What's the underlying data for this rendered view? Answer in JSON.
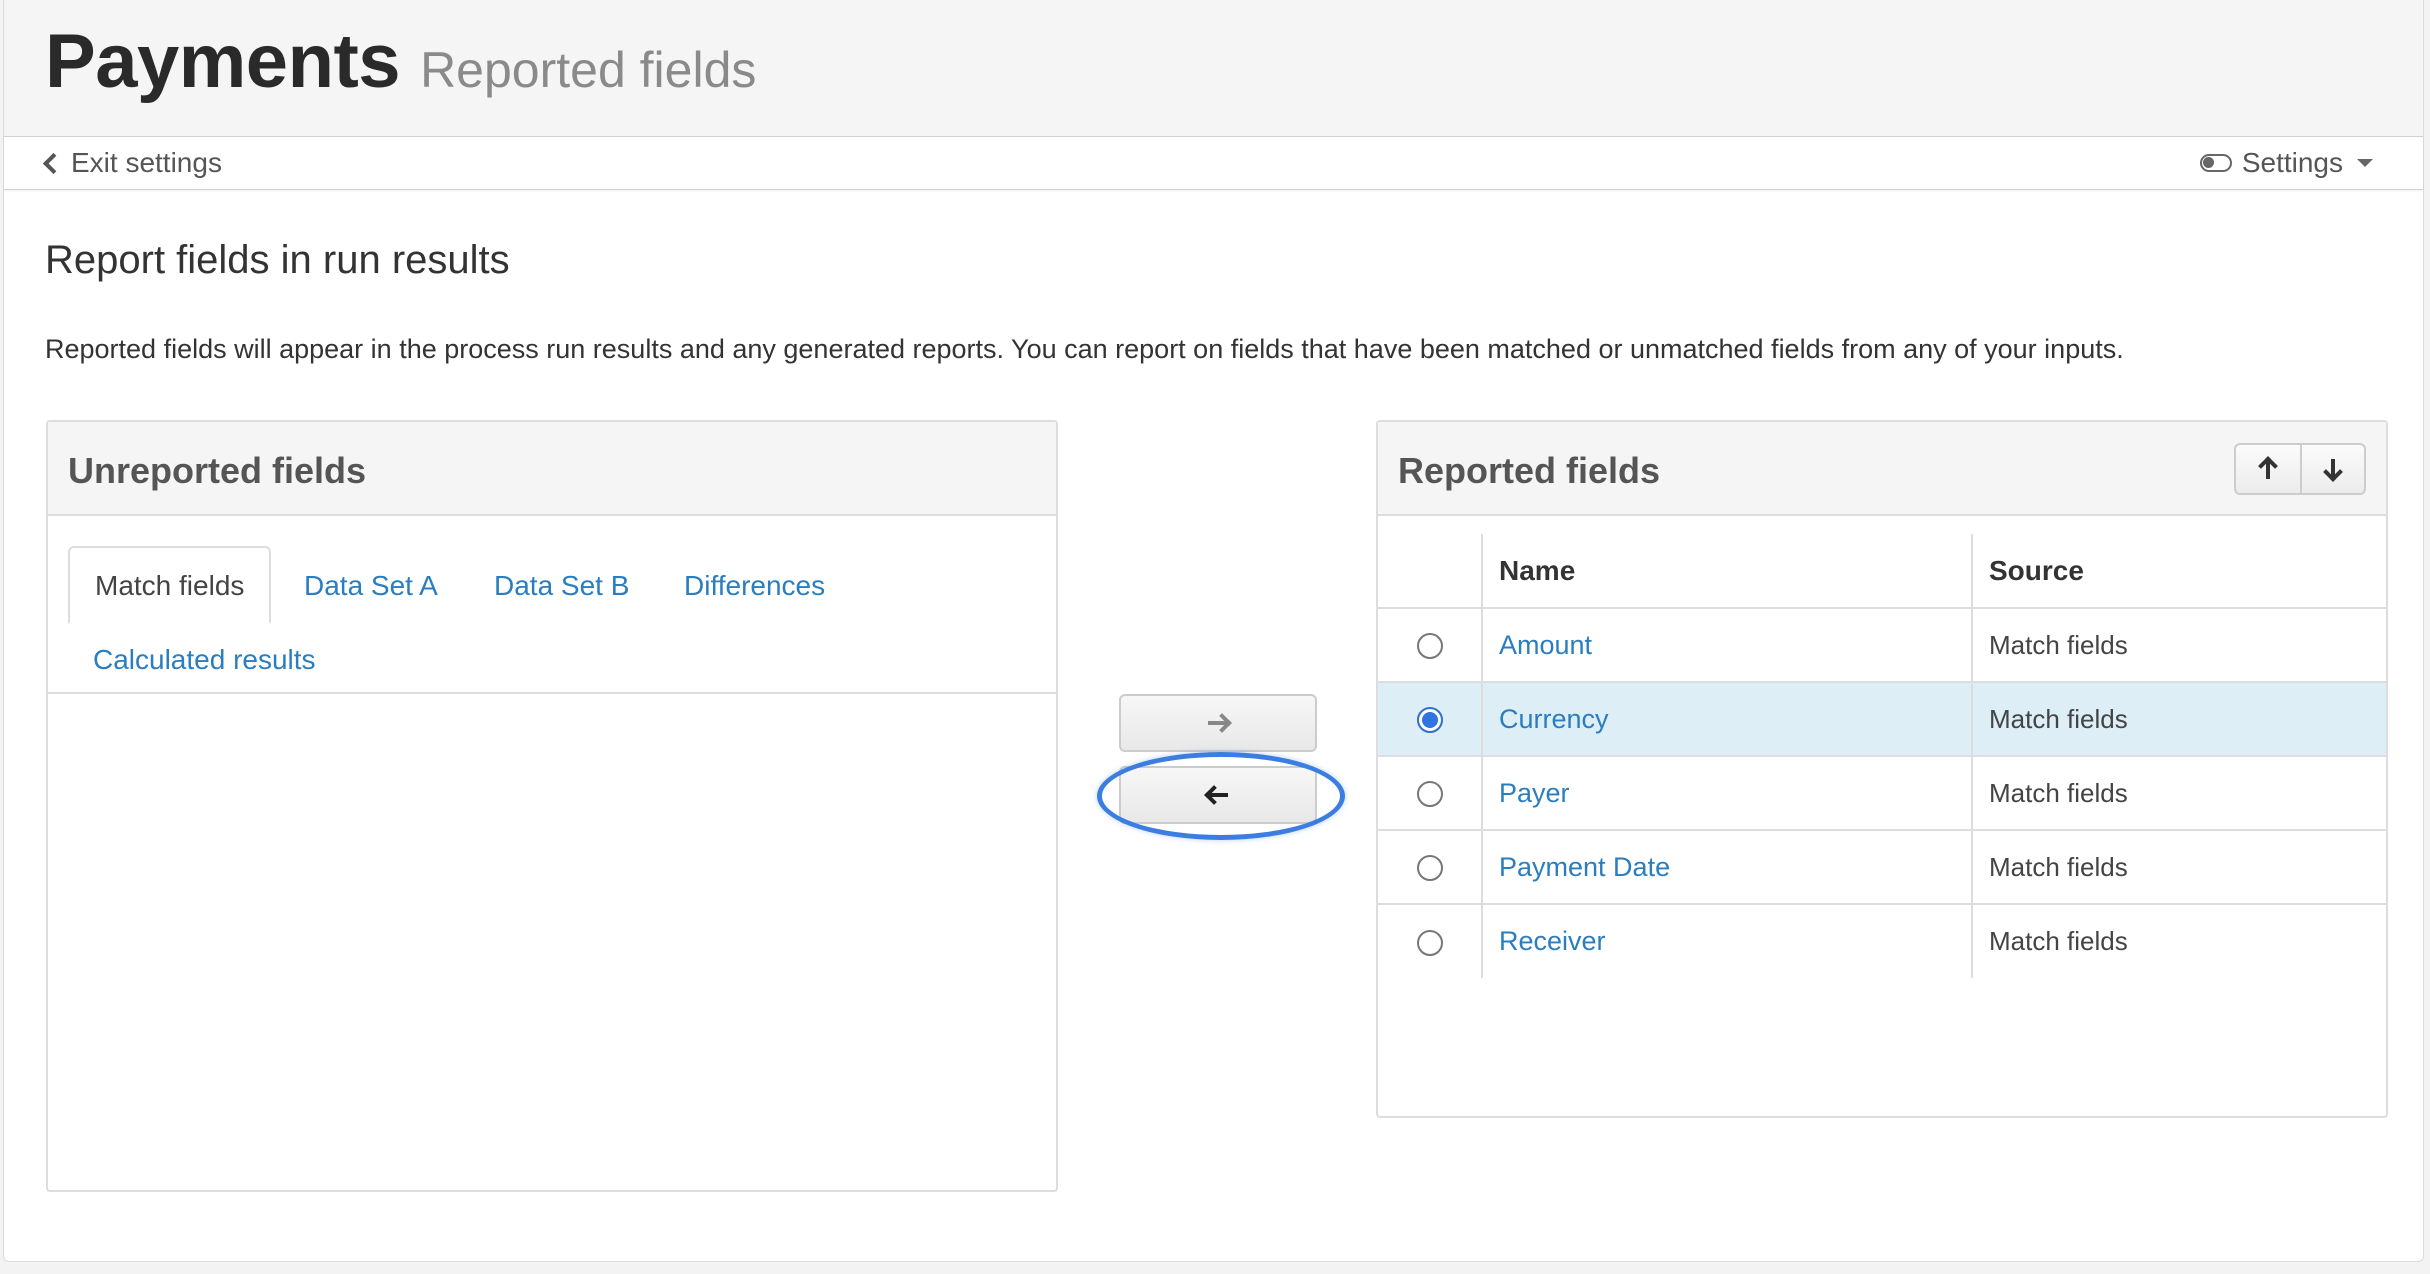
{
  "header": {
    "title": "Payments",
    "subtitle": "Reported fields"
  },
  "toolbar": {
    "exit_label": "Exit settings",
    "settings_label": "Settings"
  },
  "section": {
    "title": "Report fields in run results",
    "description": "Reported fields will appear in the process run results and any generated reports. You can report on fields that have been matched or unmatched fields from any of your inputs."
  },
  "unreported": {
    "title": "Unreported fields",
    "tabs": [
      {
        "label": "Match fields",
        "active": true
      },
      {
        "label": "Data Set A"
      },
      {
        "label": "Data Set B"
      },
      {
        "label": "Differences"
      },
      {
        "label": "Calculated results"
      }
    ]
  },
  "reported": {
    "title": "Reported fields",
    "columns": {
      "name": "Name",
      "source": "Source"
    },
    "rows": [
      {
        "name": "Amount",
        "source": "Match fields",
        "selected": false
      },
      {
        "name": "Currency",
        "source": "Match fields",
        "selected": true
      },
      {
        "name": "Payer",
        "source": "Match fields",
        "selected": false
      },
      {
        "name": "Payment Date",
        "source": "Match fields",
        "selected": false
      },
      {
        "name": "Receiver",
        "source": "Match fields",
        "selected": false
      }
    ]
  },
  "colors": {
    "link": "#2a7ebf",
    "accent": "#3b7de0",
    "selected_row": "#ddeef7"
  },
  "icons": {
    "exit": "chevron-left-icon",
    "settings": "toggle-icon",
    "move_right": "arrow-right-icon",
    "move_left": "arrow-left-icon",
    "move_up": "arrow-up-icon",
    "move_down": "arrow-down-icon"
  }
}
